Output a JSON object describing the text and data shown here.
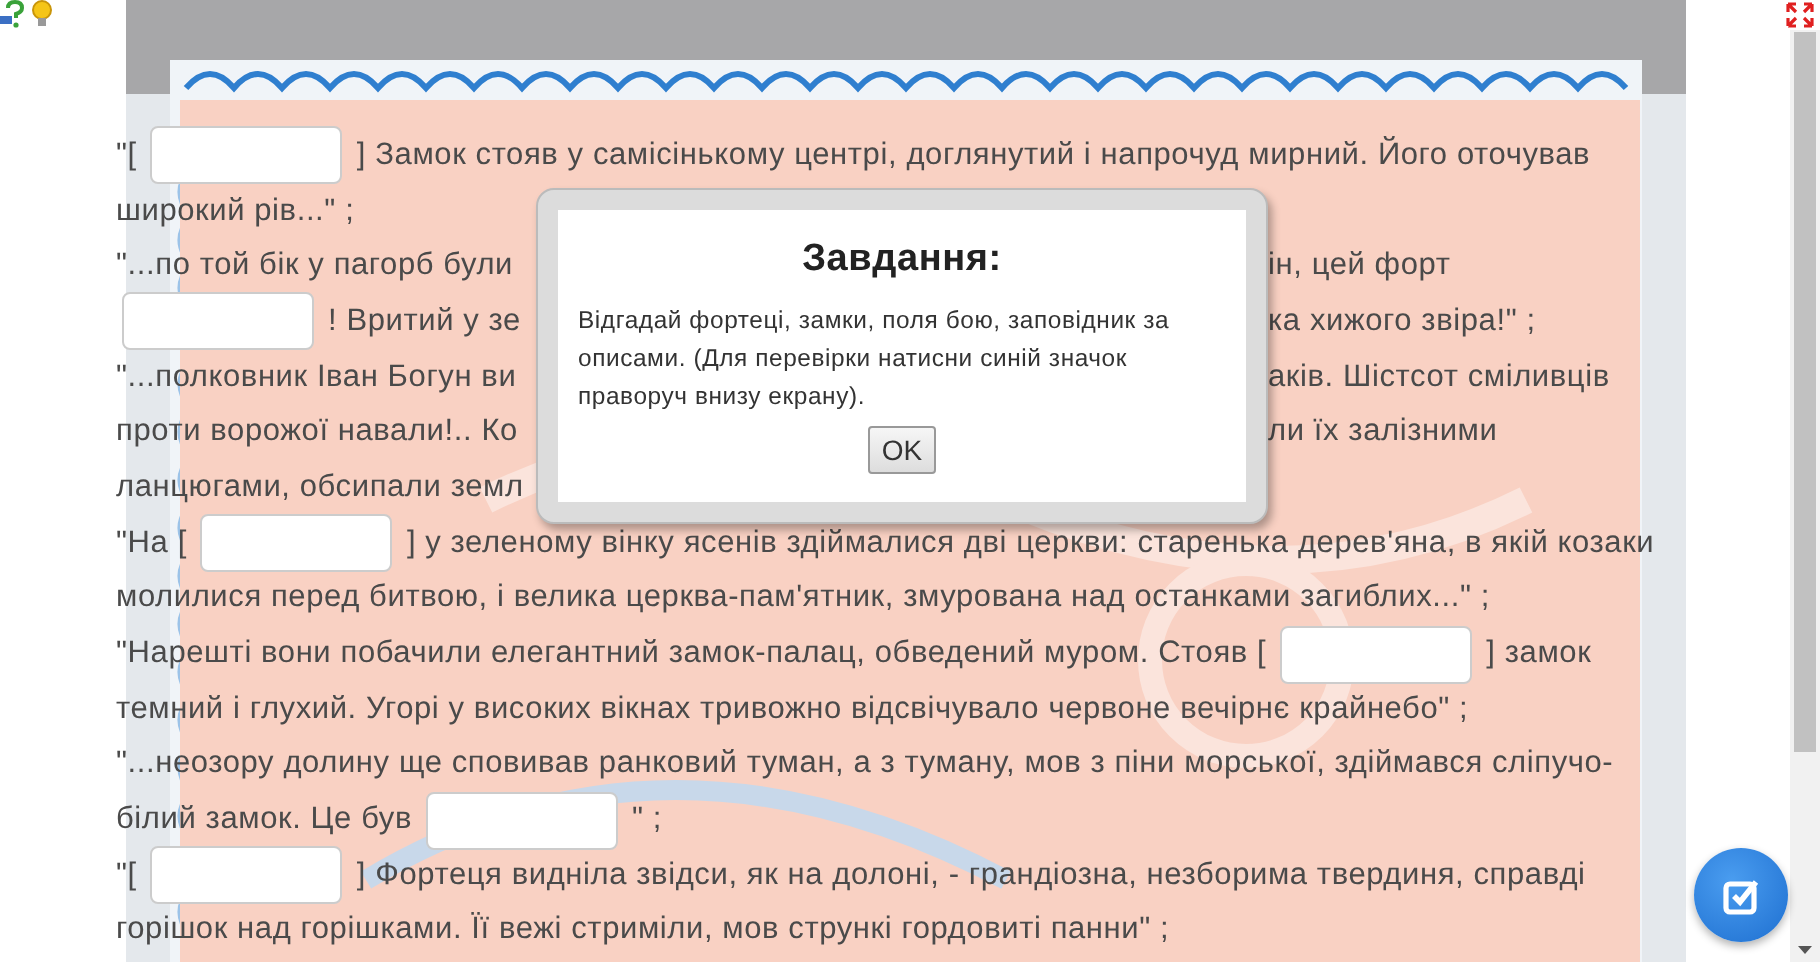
{
  "lines": [
    {
      "parts": [
        {
          "kind": "text",
          "text": "\"["
        },
        {
          "kind": "field"
        },
        {
          "kind": "text",
          "text": "] Замок стояв у самісінькому центрі, доглянутий і напрочуд мирний. Його оточував"
        }
      ]
    },
    {
      "parts": [
        {
          "kind": "text",
          "text": "широкий рів...\" ;"
        }
      ]
    },
    {
      "parts": [
        {
          "kind": "text",
          "text": "\"...по той бік у пагорб були"
        }
      ],
      "right_of_dialog": [
        {
          "kind": "text",
          "text": "ін, цей форт"
        }
      ]
    },
    {
      "parts": [
        {
          "kind": "field"
        },
        {
          "kind": "text",
          "text": "! Вритий у зе"
        }
      ],
      "right_of_dialog": [
        {
          "kind": "text",
          "text": "ка хижого звіра!\" ;"
        }
      ]
    },
    {
      "parts": [
        {
          "kind": "text",
          "text": "\"...полковник Іван Богун ви"
        }
      ],
      "right_of_dialog": [
        {
          "kind": "text",
          "text": "аків. Шістсот сміливців"
        }
      ]
    },
    {
      "parts": [
        {
          "kind": "text",
          "text": "проти ворожої навали!.. Ко"
        }
      ],
      "right_of_dialog": [
        {
          "kind": "text",
          "text": "ли їх залізними"
        }
      ]
    },
    {
      "parts": [
        {
          "kind": "text",
          "text": "ланцюгами, обсипали земл"
        }
      ]
    },
    {
      "parts": [
        {
          "kind": "text",
          "text": "\"На ["
        },
        {
          "kind": "field"
        },
        {
          "kind": "text",
          "text": "] у зеленому вінку ясенів здіймалися дві церкви: старенька дерев'яна, в якій козаки"
        }
      ]
    },
    {
      "parts": [
        {
          "kind": "text",
          "text": "молилися перед битвою, і велика церква-пам'ятник, змурована над останками загиблих...\" ;"
        }
      ]
    },
    {
      "parts": [
        {
          "kind": "text",
          "text": "\"Нарешті вони побачили елегантний замок-палац, обведений муром. Стояв ["
        },
        {
          "kind": "field"
        },
        {
          "kind": "text",
          "text": "] замок"
        }
      ]
    },
    {
      "parts": [
        {
          "kind": "text",
          "text": "темний і глухий. Угорі у високих вікнах тривожно відсвічувало червоне вечірнє крайнебо\" ;"
        }
      ]
    },
    {
      "parts": [
        {
          "kind": "text",
          "text": "\"...неозору долину ще сповивав ранковий туман, а з туману, мов з піни морської, здіймався сліпучо-"
        }
      ]
    },
    {
      "parts": [
        {
          "kind": "text",
          "text": "білий замок. Це був"
        },
        {
          "kind": "field"
        },
        {
          "kind": "text",
          "text": "\" ;"
        }
      ]
    },
    {
      "parts": [
        {
          "kind": "text",
          "text": "\"["
        },
        {
          "kind": "field"
        },
        {
          "kind": "text",
          "text": "] Фортеця виднiла звідси, як на долоні, - грандіозна, незборима твердиня, справді"
        }
      ]
    },
    {
      "parts": [
        {
          "kind": "text",
          "text": "горішок над горішками. Її вежі стриміли, мов стрункі гордовиті панни\" ;"
        }
      ]
    }
  ],
  "dialog": {
    "title": "Завдання:",
    "message": "Відгадай фортеці, замки, поля бою, заповідник за описами. (Для перевірки натисни синій значок праворуч внизу екрану).",
    "button": "OK"
  }
}
